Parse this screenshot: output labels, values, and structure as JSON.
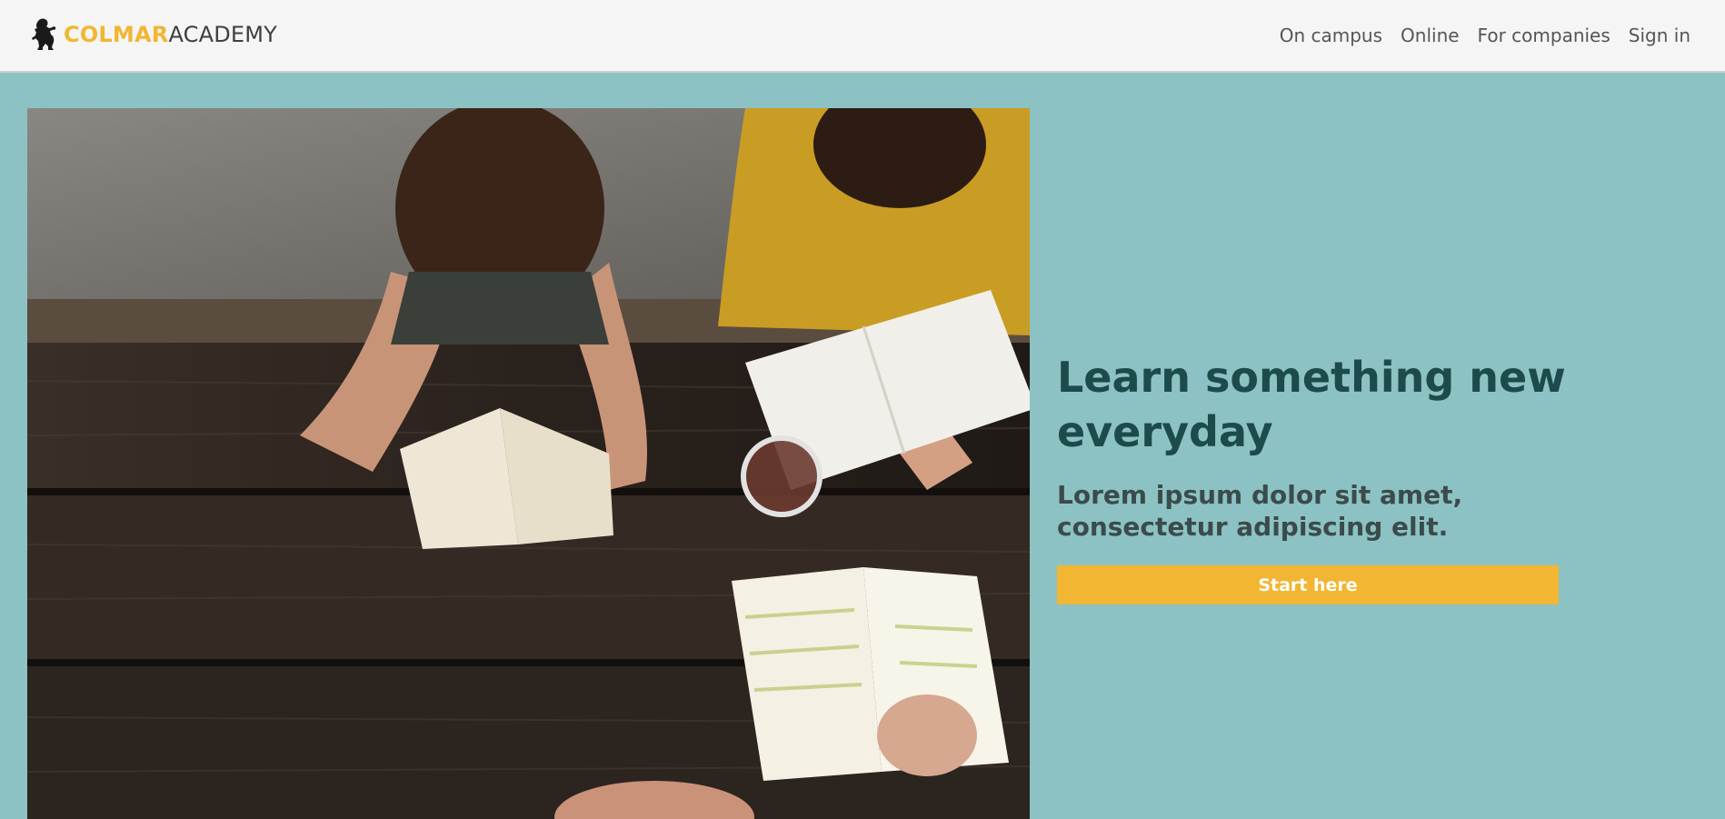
{
  "header": {
    "logo": {
      "brand": "COLMAR",
      "rest": "ACADEMY",
      "icon": "lion-rampant-icon"
    },
    "nav": [
      {
        "label": "On campus"
      },
      {
        "label": "Online"
      },
      {
        "label": "For companies"
      },
      {
        "label": "Sign in"
      }
    ]
  },
  "hero": {
    "image": "students-studying-on-picnic-table-photo",
    "title": "Learn something new everyday",
    "subtitle": "Lorem ipsum dolor sit amet, consectetur adipiscing elit.",
    "cta_label": "Start here"
  },
  "colors": {
    "accent": "#f2b632",
    "background": "#8cc2c3",
    "header_bg": "#f5f5f5",
    "title": "#1d4a4a",
    "subtitle": "#3b4b4b"
  }
}
